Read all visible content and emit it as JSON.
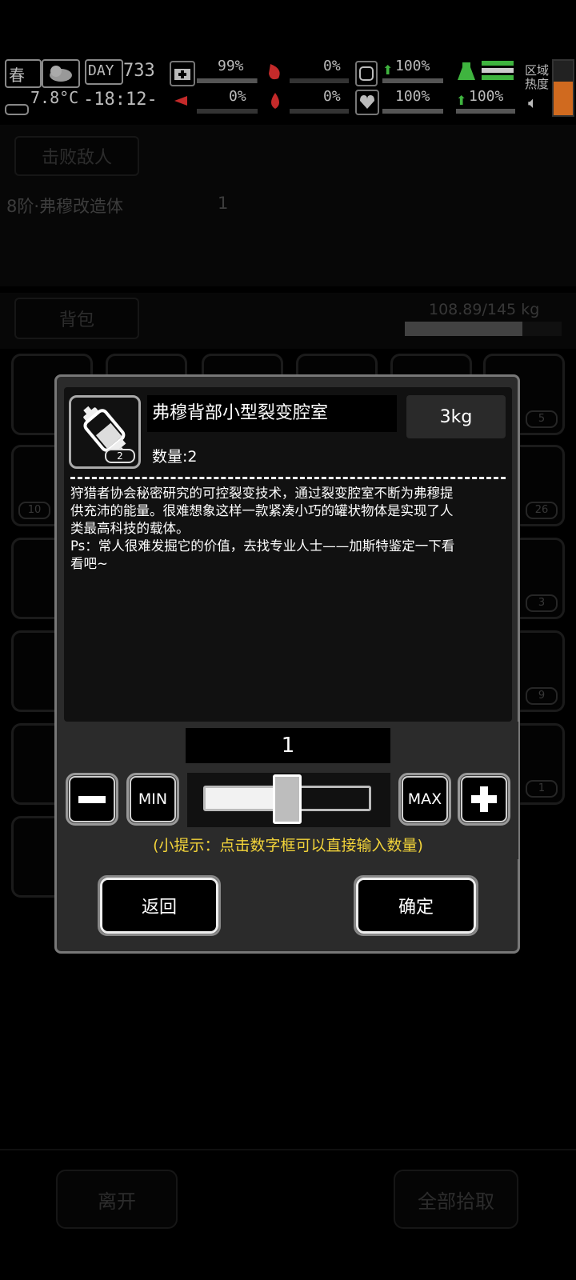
{
  "status_bar": {
    "season": "春",
    "day_label": "DAY",
    "day_value": "733",
    "temperature": "7.8°C",
    "time": "-18:12-",
    "stats": [
      {
        "icon": "medkit-icon",
        "value": "99%"
      },
      {
        "icon": "blood-drop-icon",
        "value": "0%"
      },
      {
        "icon": "stomach-icon",
        "value": "100%"
      },
      {
        "icon": "infection-icon",
        "value": "0%"
      },
      {
        "icon": "water-drop-icon",
        "value": "0%"
      },
      {
        "icon": "heart-icon",
        "value": "100%"
      },
      {
        "icon": "flask-icon",
        "value": "100%"
      }
    ],
    "region_heat_label_1": "区域",
    "region_heat_label_2": "热度"
  },
  "background": {
    "defeat_tab": "击败敌人",
    "enemy_name": "8阶·弗穆改造体",
    "enemy_count": "1",
    "backpack_tab": "背包",
    "weight": "108.89/145 kg",
    "weight_fraction": 0.75,
    "slot_counts": [
      "5",
      "10",
      "26",
      "3",
      "9",
      "1"
    ],
    "leave_button": "离开",
    "pick_all_button": "全部拾取"
  },
  "modal": {
    "item_name": "弗穆背部小型裂变腔室",
    "item_weight": "3kg",
    "item_slot_count": "2",
    "quantity_label": "数量:2",
    "description_lines": [
      "狩猎者协会秘密研究的可控裂变技术，通过裂变腔室不断为弗穆提",
      "供充沛的能量。很难想象这样一款紧凑小巧的罐状物体是实现了人",
      "类最高科技的载体。",
      "Ps：常人很难发掘它的价值，去找专业人士——加斯特鉴定一下看",
      "看吧~"
    ],
    "selected_quantity": "1",
    "slider_fraction": 0.5,
    "min_label": "MIN",
    "max_label": "MAX",
    "hint": "(小提示：点击数字框可以直接输入数量)",
    "back_button": "返回",
    "confirm_button": "确定"
  },
  "colors": {
    "hint": "#f2d33a",
    "good": "#3fb43f",
    "bad": "#c42a2a",
    "heat_bar": "#d06a1f"
  }
}
